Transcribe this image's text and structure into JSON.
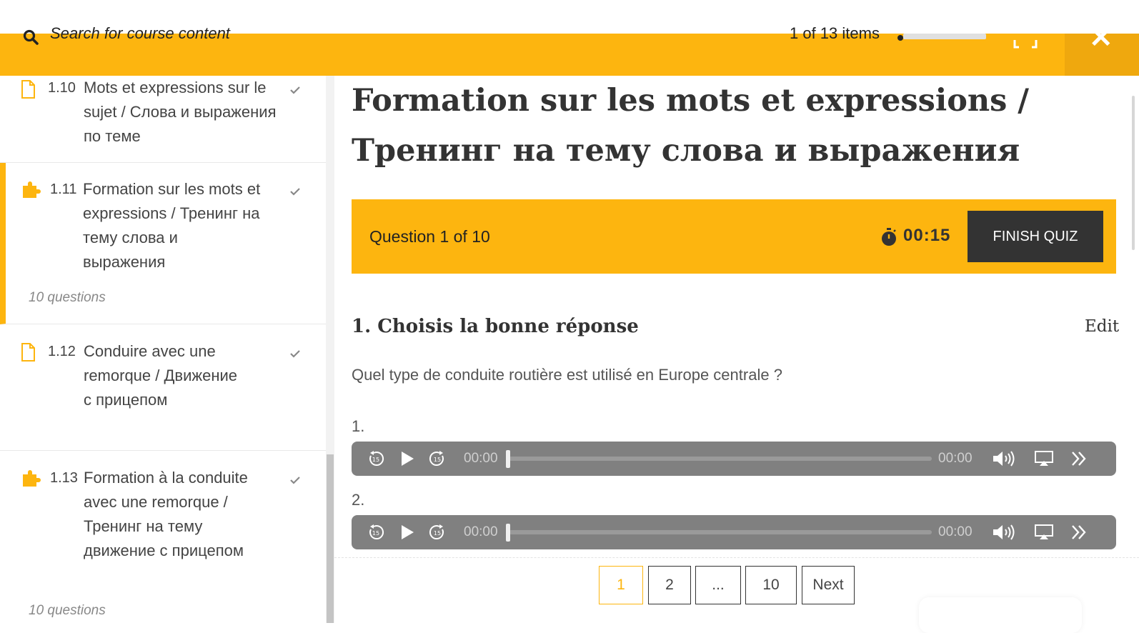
{
  "topbar": {
    "search_placeholder": "Search for course content",
    "items_count": "1 of 13 items"
  },
  "sidebar": {
    "items": [
      {
        "num": "1.10",
        "title": "Mots et expressions sur le sujet / Слова и выражения по теме",
        "sub": "",
        "icon": "document-icon"
      },
      {
        "num": "1.11",
        "title": "Formation sur les mots et expressions / Тренинг на тему слова и выражения",
        "sub": "10 questions",
        "icon": "puzzle-icon"
      },
      {
        "num": "1.12",
        "title": "Conduire avec une remorque / Движение с прицепом",
        "sub": "",
        "icon": "document-icon"
      },
      {
        "num": "1.13",
        "title": "Formation à la conduite avec une remorque / Тренинг на тему движение с прицепом",
        "sub": "10 questions",
        "icon": "puzzle-icon"
      }
    ]
  },
  "main": {
    "title": "Formation sur les mots et expressions / Тренинг на тему слова и выражения",
    "quiz": {
      "question_counter": "Question 1 of 10",
      "timer": "00:15",
      "finish_label": "FINISH QUIZ"
    },
    "question": {
      "heading": "1. Choisis la bonne réponse",
      "edit_label": "Edit",
      "text": "Quel type de conduite routière est utilisé en Europe centrale ?",
      "answers": [
        {
          "label": "1.",
          "current_time": "00:00",
          "duration": "00:00"
        },
        {
          "label": "2.",
          "current_time": "00:00",
          "duration": "00:00"
        }
      ]
    },
    "pagination": {
      "pages": [
        "1",
        "2",
        "...",
        "10"
      ],
      "next_label": "Next",
      "current": "1"
    }
  },
  "colors": {
    "accent": "#FDB50F",
    "accent_dark": "#EFA80E",
    "dark": "#333333",
    "player_bg": "#808080"
  }
}
